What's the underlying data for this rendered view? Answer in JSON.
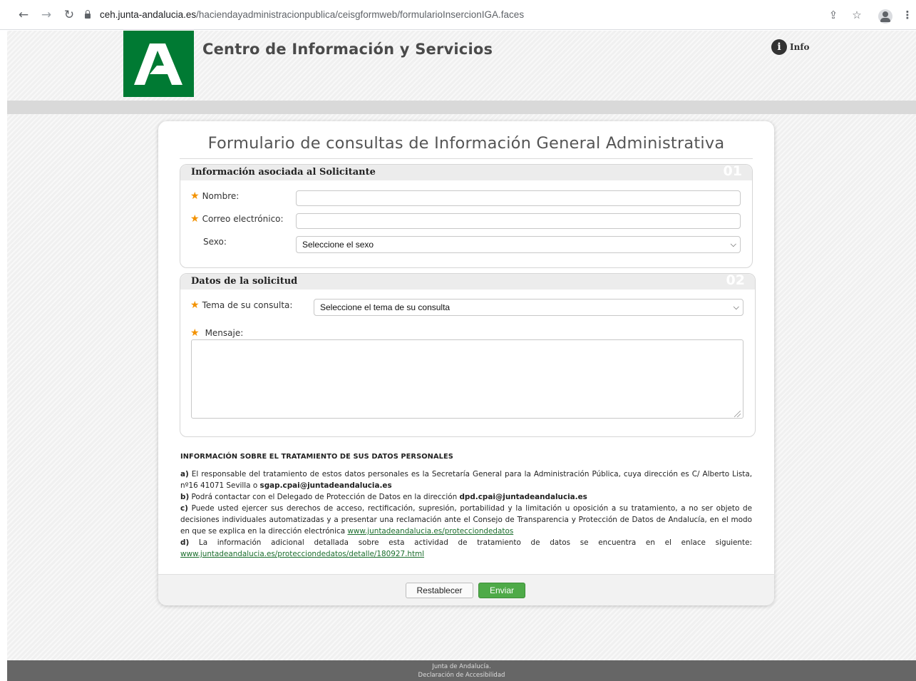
{
  "browser": {
    "url_host": "ceh.junta-andalucia.es",
    "url_path": "/haciendayadministracionpublica/ceisgformweb/formularioInsercionIGA.faces",
    "back_icon": "arrow-left-icon",
    "forward_icon": "arrow-right-icon",
    "reload_icon": "reload-icon"
  },
  "header": {
    "site_title": "Centro de Información y Servicios",
    "info_label": "Info",
    "info_icon_glyph": "i"
  },
  "form": {
    "title": "Formulario de consultas de Información General Administrativa",
    "section1": {
      "title": "Información asociada al Solicitante",
      "number": "01",
      "fields": {
        "nombre_label": "Nombre:",
        "nombre_value": "",
        "correo_label": "Correo electrónico:",
        "correo_value": "",
        "sexo_label": "Sexo:",
        "sexo_selected": "Seleccione el sexo"
      }
    },
    "section2": {
      "title": "Datos de la solicitud",
      "number": "02",
      "fields": {
        "tema_label": "Tema de su consulta:",
        "tema_selected": "Seleccione el tema de su consulta",
        "mensaje_label": "Mensaje:",
        "mensaje_value": ""
      }
    },
    "required_star": "★"
  },
  "legal": {
    "heading": "INFORMACIÓN SOBRE EL TRATAMIENTO DE SUS DATOS PERSONALES",
    "a_letter": "a)",
    "a_text": "El responsable del tratamiento de estos datos personales es la Secretaría General para la Administración Pública, cuya dirección es C/ Alberto Lista, nº16 41071 Sevilla o",
    "a_email": "sgap.cpai@juntadeandalucia.es",
    "b_letter": "b)",
    "b_text": "Podrá contactar con el Delegado de Protección de Datos en la dirección",
    "b_email": "dpd.cpai@juntadeandalucia.es",
    "c_letter": "c)",
    "c_text": "Puede usted ejercer sus derechos de acceso, rectificación, supresión, portabilidad y la limitación u oposición a su tratamiento, a no ser objeto de decisiones individuales automatizadas y a presentar una reclamación ante el Consejo de Transparencia y Protección de Datos de Andalucía, en el modo en que se explica en la dirección electrónica",
    "c_link": "www.juntadeandalucia.es/protecciondedatos",
    "d_letter": "d)",
    "d_text": "La información adicional detallada sobre esta actividad de tratamiento de datos se encuentra en el enlace siguiente:",
    "d_link": "www.juntadeandalucia.es/protecciondedatos/detalle/180927.html"
  },
  "buttons": {
    "reset_label": "Restablecer",
    "send_label": "Enviar"
  },
  "footer": {
    "line1": "Junta de Andalucía.",
    "line2": "Declaración de Accesibilidad"
  },
  "colors": {
    "junta_green": "#007a33",
    "send_green": "#4eaa48",
    "required_orange": "#f39200",
    "link_green": "#1b6e2d"
  }
}
